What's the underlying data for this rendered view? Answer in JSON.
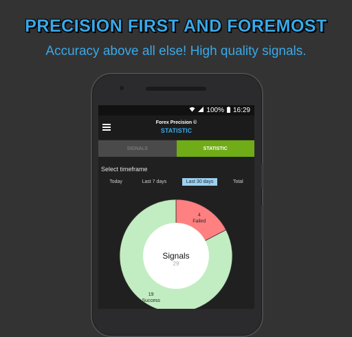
{
  "headline": "PRECISION FIRST AND FOREMOST",
  "subline": "Accuracy above all else! High quality signals.",
  "status": {
    "battery": "100%",
    "time": "16:29"
  },
  "app": {
    "title": "Forex Precision ©",
    "subtitle": "STATISTIC"
  },
  "tabs": [
    {
      "label": "SIGNALS",
      "active": false
    },
    {
      "label": "STATISTIC",
      "active": true
    }
  ],
  "timeframe": {
    "label": "Select timeframe",
    "options": [
      "Today",
      "Last 7 days",
      "Last 30 days",
      "Total"
    ],
    "selected": "Last 30 days"
  },
  "colors": {
    "accent": "#3aa8e8",
    "active_tab": "#6fac17",
    "success": "#c2ecc2",
    "failed": "#ff8080",
    "selected_chip": "#9cd1ef"
  },
  "chart_data": {
    "type": "pie",
    "center_label": "Signals",
    "center_value": "29",
    "slices": [
      {
        "name": "Failed",
        "value": 4
      },
      {
        "name": "Success",
        "value": 19
      }
    ]
  }
}
